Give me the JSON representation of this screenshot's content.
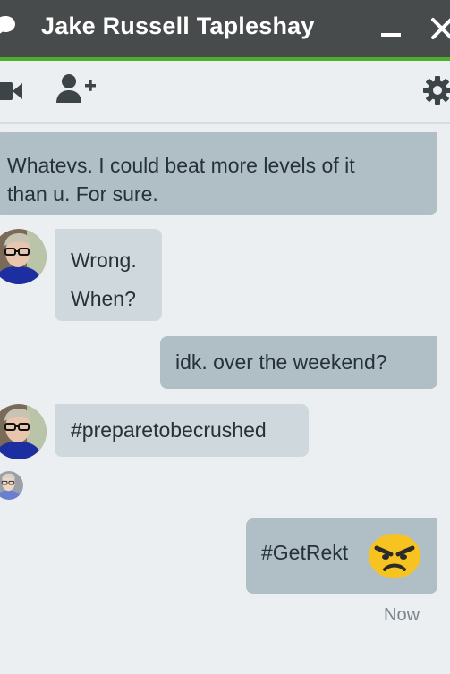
{
  "window": {
    "title": "Jake Russell Tapleshay"
  },
  "icons": {
    "chat_bubble": "chat-bubble-icon",
    "minimize": "minimize-icon",
    "close": "close-icon",
    "video": "video-camera-icon",
    "add_person": "add-person-icon",
    "settings": "gear-icon",
    "emoji": "angry-face-emoji"
  },
  "colors": {
    "titlebar": "#474b4b",
    "accent": "#4caf2a",
    "outgoing_bubble": "#b0bec5",
    "incoming_bubble": "#cfd8dc",
    "background": "#eceff1"
  },
  "messages": [
    {
      "direction": "outgoing",
      "lines": [
        "Whatevs. I could beat more levels of it",
        "than u. For sure."
      ]
    },
    {
      "direction": "incoming",
      "lines": [
        "Wrong.",
        "When?"
      ]
    },
    {
      "direction": "outgoing",
      "lines": [
        "idk. over the weekend?"
      ]
    },
    {
      "direction": "incoming",
      "lines": [
        "#preparetobecrushed"
      ]
    },
    {
      "direction": "outgoing",
      "lines": [
        "#GetRekt"
      ]
    }
  ],
  "status": {
    "timestamp": "Now"
  },
  "close_glyph": "✕"
}
